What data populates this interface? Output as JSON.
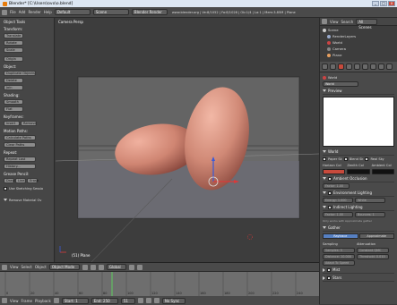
{
  "window": {
    "title": "Blender* [C:\\Users\\ovo\\o.blend]",
    "buttons": {
      "minimize": "_",
      "maximize": "□",
      "close": "x"
    }
  },
  "infobar": {
    "menus": [
      "File",
      "Add",
      "Render",
      "Help"
    ],
    "screen_field": "Default",
    "scene_field": "Scene",
    "engine_field": "Blender Render",
    "stats": "www.blender.org | Ve:8/1052 | Fa:8/1028 | Ob:1/4 | La:1 | Mem:3.85M | Plane"
  },
  "toolshelf": {
    "title": "Object Tools",
    "sections": [
      {
        "name": "Transform:",
        "buttons": [
          "Translate",
          "Rotate",
          "Scale"
        ]
      },
      {
        "name": "",
        "buttons": [
          "Origin"
        ]
      },
      {
        "name": "Object:",
        "buttons": [
          "Duplicate Objects",
          "Delete",
          "Join"
        ]
      },
      {
        "name": "Shading:",
        "buttons": [
          "Smooth",
          "Flat"
        ]
      },
      {
        "name": "Keyframes:",
        "buttons": [
          "Insert",
          "Remove"
        ]
      },
      {
        "name": "Motion Paths:",
        "buttons": [
          "Calculate Paths",
          "Clear Paths"
        ]
      },
      {
        "name": "Repeat:",
        "buttons": [
          "Repeat Last",
          "History..."
        ]
      },
      {
        "name": "Grease Pencil:",
        "buttons": [
          "Draw",
          "Line",
          "Erase"
        ]
      }
    ],
    "sketching_label": "Use Sketching Sessio",
    "remove_material": "Remove Material Ov"
  },
  "viewport": {
    "label": "Camera Persp",
    "object_label": "(51) Plane",
    "header": {
      "menus": [
        "View",
        "Select",
        "Object"
      ],
      "mode": "Object Mode",
      "pivot": "Global"
    }
  },
  "timeline": {
    "menus": [
      "View",
      "Frame",
      "Playback"
    ],
    "start": "Start: 1",
    "end": "End: 250",
    "current": "51",
    "sync": "No Sync",
    "ticks": [
      "0",
      "20",
      "40",
      "60",
      "80",
      "100",
      "120",
      "140",
      "160",
      "180",
      "200",
      "220",
      "240"
    ]
  },
  "outliner": {
    "menus": [
      "View",
      "Search",
      "All Scenes"
    ],
    "items": [
      "Scene",
      "RenderLayers",
      "World",
      "Camera",
      "Plane"
    ]
  },
  "properties": {
    "world_field": "World",
    "preview_label": "Preview",
    "world_panel": "World",
    "checks": [
      "Paper Sk",
      "Blend Sk",
      "Real Sky"
    ],
    "color_labels": [
      "Horizon Col",
      "Zenith Col",
      "Ambient Col"
    ],
    "panels": [
      "Ambient Occlusion",
      "Environment Lighting",
      "Indirect Lighting",
      "Gather",
      "Mist",
      "Stars"
    ],
    "ao_factor": "Factor: 1.00",
    "env_energy": "Energy: 1.000",
    "env_color": "White",
    "ind_factor": "Factor: 1.00",
    "ind_bounces": "Bounces: 1",
    "ind_note": "Only works with Approximate gather",
    "gather_tabs": [
      "Raytrace",
      "Approximate"
    ],
    "gather_fields": [
      "Sampling",
      "Attenuation",
      "Samples: 5",
      "Constant QMC",
      "Distance: 10.000",
      "Threshold: 0.010",
      "Adapt To Speed"
    ]
  },
  "colors": {
    "accent": "#c74a3c",
    "egg": "#d08976",
    "selected": "#5680c2"
  }
}
